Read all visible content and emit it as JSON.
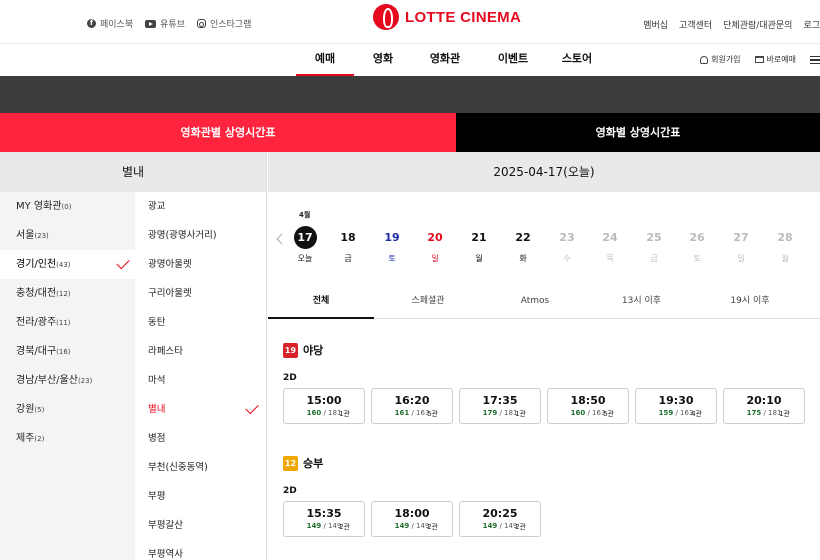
{
  "header": {
    "social": [
      {
        "label": "페이스북",
        "icon": "facebook-icon"
      },
      {
        "label": "유튜브",
        "icon": "youtube-icon"
      },
      {
        "label": "인스타그램",
        "icon": "instagram-icon"
      }
    ],
    "logo_text": "LOTTE CINEMA",
    "util": [
      "멤버십",
      "고객센터",
      "단체관람/대관문의",
      "로그"
    ],
    "nav": [
      "예매",
      "영화",
      "영화관",
      "이벤트",
      "스토어"
    ],
    "nav_active": "예매",
    "right_links": {
      "signup": "회원가입",
      "quick": "바로예매"
    }
  },
  "tabs": {
    "by_cinema": "영화관별 상영시간표",
    "by_movie": "영화별 상영시간표"
  },
  "left": {
    "selected_cinema_title": "별내",
    "regions": [
      {
        "name": "MY 영화관",
        "count": "(0)"
      },
      {
        "name": "서울",
        "count": "(23)"
      },
      {
        "name": "경기/인천",
        "count": "(43)",
        "selected": true
      },
      {
        "name": "충청/대전",
        "count": "(12)"
      },
      {
        "name": "전라/광주",
        "count": "(11)"
      },
      {
        "name": "경북/대구",
        "count": "(16)"
      },
      {
        "name": "경남/부산/울산",
        "count": "(23)"
      },
      {
        "name": "강원",
        "count": "(5)"
      },
      {
        "name": "제주",
        "count": "(2)"
      }
    ],
    "cinemas": [
      {
        "name": "광교"
      },
      {
        "name": "광명(광명사거리)"
      },
      {
        "name": "광명아울렛"
      },
      {
        "name": "구리아울렛"
      },
      {
        "name": "동탄"
      },
      {
        "name": "라페스타"
      },
      {
        "name": "마석"
      },
      {
        "name": "별내",
        "selected": true
      },
      {
        "name": "병점"
      },
      {
        "name": "부천(신중동역)"
      },
      {
        "name": "부평"
      },
      {
        "name": "부평갈산"
      },
      {
        "name": "부평역사"
      }
    ]
  },
  "right": {
    "date_title": "2025-04-17(오늘)",
    "month": "4월",
    "days": [
      {
        "num": "17",
        "wd": "오늘",
        "kind": "today"
      },
      {
        "num": "18",
        "wd": "금",
        "kind": "norm"
      },
      {
        "num": "19",
        "wd": "토",
        "kind": "sat"
      },
      {
        "num": "20",
        "wd": "일",
        "kind": "sun"
      },
      {
        "num": "21",
        "wd": "월",
        "kind": "norm"
      },
      {
        "num": "22",
        "wd": "화",
        "kind": "norm"
      },
      {
        "num": "23",
        "wd": "수",
        "kind": "dis"
      },
      {
        "num": "24",
        "wd": "목",
        "kind": "dis"
      },
      {
        "num": "25",
        "wd": "금",
        "kind": "dis"
      },
      {
        "num": "26",
        "wd": "토",
        "kind": "dis"
      },
      {
        "num": "27",
        "wd": "일",
        "kind": "dis"
      },
      {
        "num": "28",
        "wd": "월",
        "kind": "dis"
      }
    ],
    "filters": [
      "전체",
      "스페셜관",
      "Atmos",
      "13시 이후",
      "19시 이후"
    ],
    "filter_active": "전체",
    "movies": [
      {
        "rating": "19",
        "title": "야당",
        "format": "2D",
        "times": [
          {
            "time": "15:00",
            "avail": "160",
            "total": "181",
            "hall": "1관"
          },
          {
            "time": "16:20",
            "avail": "161",
            "total": "163",
            "hall": "5관"
          },
          {
            "time": "17:35",
            "avail": "179",
            "total": "181",
            "hall": "1관"
          },
          {
            "time": "18:50",
            "avail": "160",
            "total": "163",
            "hall": "5관"
          },
          {
            "time": "19:30",
            "avail": "159",
            "total": "163",
            "hall": "4관"
          },
          {
            "time": "20:10",
            "avail": "175",
            "total": "181",
            "hall": "1관"
          }
        ]
      },
      {
        "rating": "12",
        "title": "승부",
        "format": "2D",
        "times": [
          {
            "time": "15:35",
            "avail": "149",
            "total": "149",
            "hall": "2관"
          },
          {
            "time": "18:00",
            "avail": "149",
            "total": "149",
            "hall": "2관"
          },
          {
            "time": "20:25",
            "avail": "149",
            "total": "149",
            "hall": "2관"
          }
        ]
      }
    ]
  },
  "colors": {
    "brand": "#e50a1e",
    "tab_active": "#ff243e",
    "saturday": "#1b2aa5",
    "seat_available": "#1b6e2a"
  }
}
